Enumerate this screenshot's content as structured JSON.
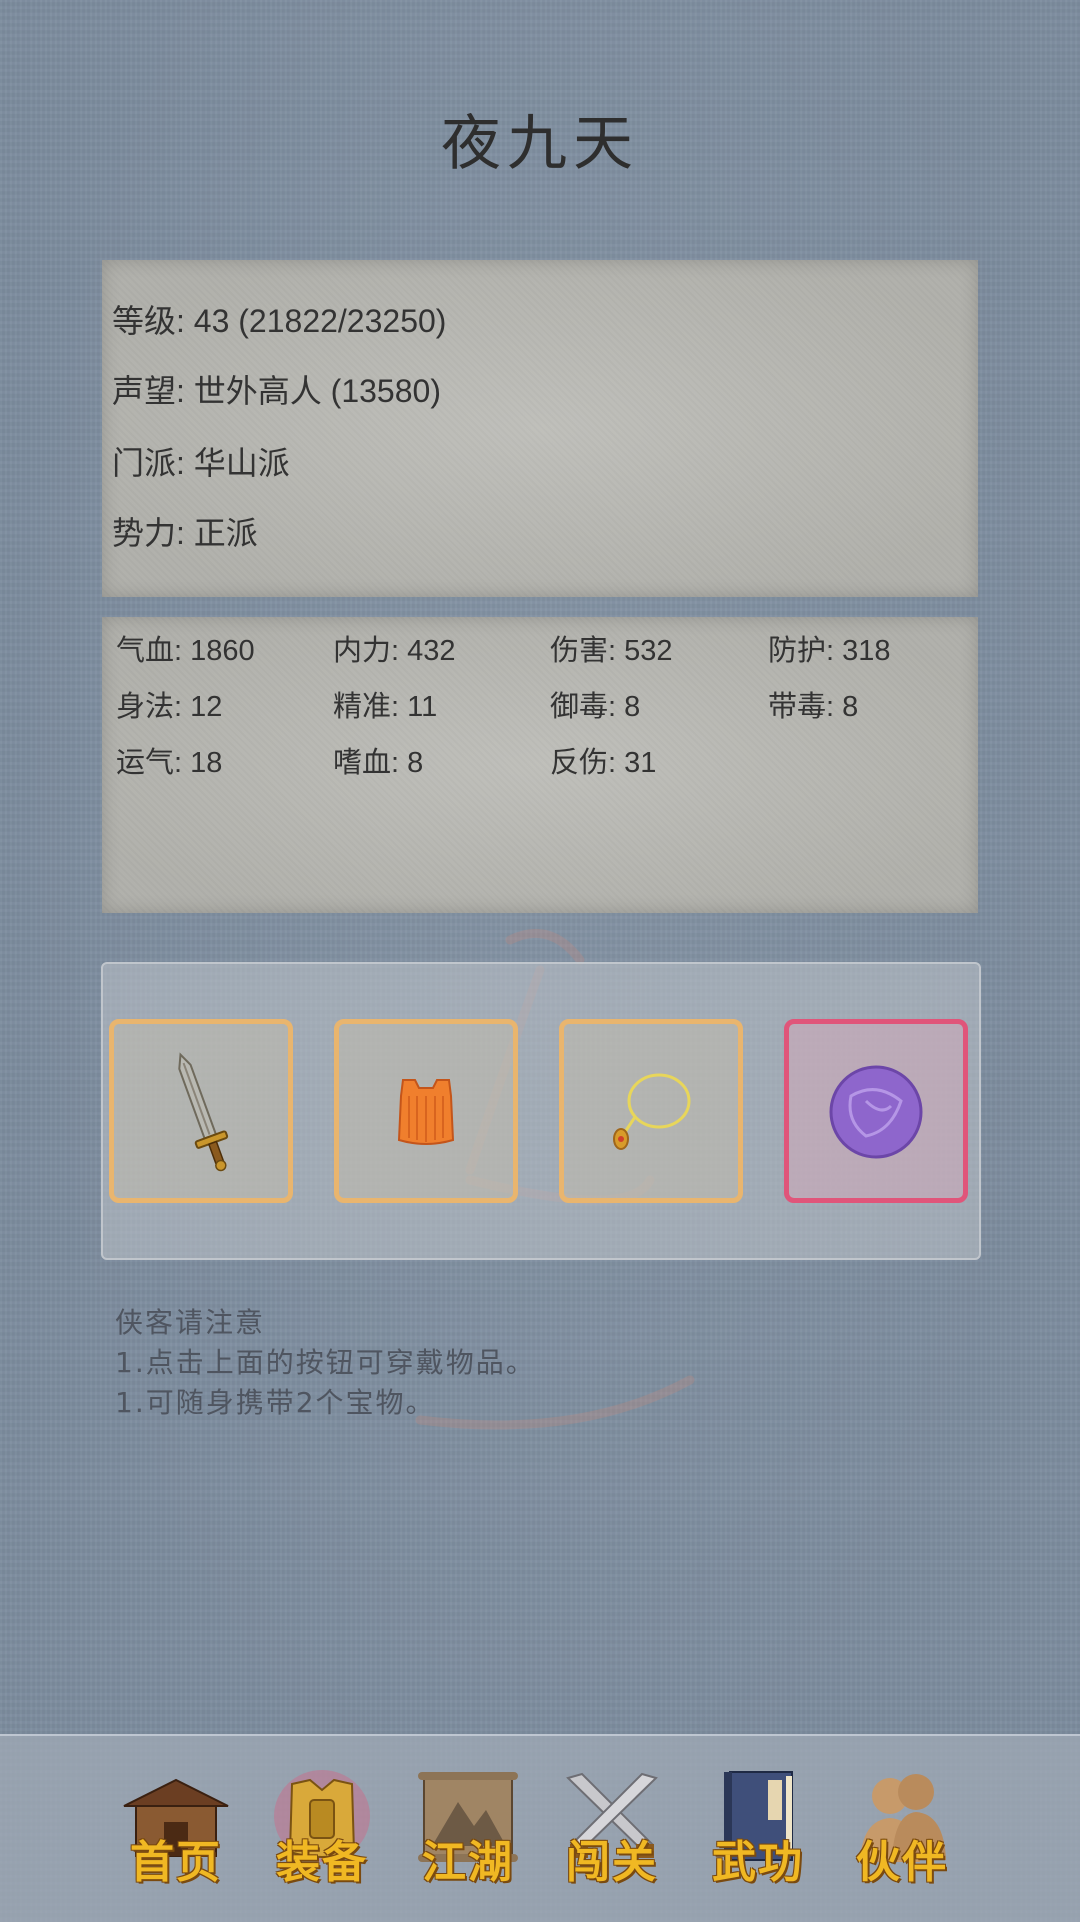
{
  "header": {
    "character_name": "夜九天"
  },
  "info": {
    "level": "等级: 43 (21822/23250)",
    "reputation": "声望: 世外高人 (13580)",
    "sect": "门派: 华山派",
    "faction": "势力:  正派"
  },
  "stats": [
    "气血: 1860",
    "内力: 432",
    "伤害: 532",
    "防护: 318",
    "身法: 12",
    "精准: 11",
    "御毒: 8",
    "带毒: 8",
    "运气: 18",
    "嗜血: 8",
    "反伤: 31"
  ],
  "equipment": [
    {
      "icon": "sword-icon",
      "color": "#e9b56e"
    },
    {
      "icon": "armor-icon",
      "color": "#e9b56e"
    },
    {
      "icon": "necklace-icon",
      "color": "#e9b56e"
    },
    {
      "icon": "purple-orb-icon",
      "color": "#e0557a"
    }
  ],
  "notice": {
    "title": "侠客请注意",
    "line1": "1.点击上面的按钮可穿戴物品。",
    "line2": "1.可随身携带2个宝物。"
  },
  "nav": {
    "home": "首页",
    "equipment": "装备",
    "jianghu": "江湖",
    "challenge": "闯关",
    "martial": "武功",
    "partner": "伙伴"
  },
  "colors": {
    "accent": "#f0b823",
    "slot_border": "#e9b56e",
    "special_border": "#e0557a"
  }
}
